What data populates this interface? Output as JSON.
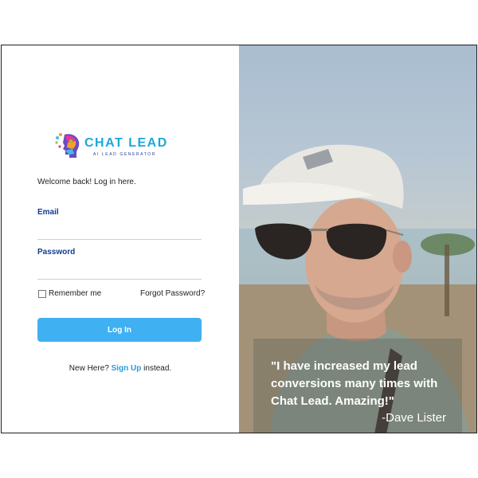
{
  "logo": {
    "title": "CHAT LEAD",
    "subtitle": "AI LEAD GENERATOR",
    "colors": {
      "title": "#1ea7d9",
      "accent": "#e23c8e"
    }
  },
  "login": {
    "welcome": "Welcome back! Log in here.",
    "email_label": "Email",
    "email_value": "",
    "password_label": "Password",
    "password_value": "",
    "remember_label": "Remember me",
    "remember_checked": false,
    "forgot_label": "Forgot Password?",
    "login_button": "Log In",
    "signup_prefix": "New Here?",
    "signup_link": "Sign Up",
    "signup_suffix": "instead."
  },
  "testimonial": {
    "quote": "\"I have increased my lead conversions many times with Chat Lead. Amazing!\"",
    "author": "-Dave Lister"
  },
  "colors": {
    "button": "#3fb0f2",
    "label": "#123c8f",
    "link": "#2c9be0"
  }
}
